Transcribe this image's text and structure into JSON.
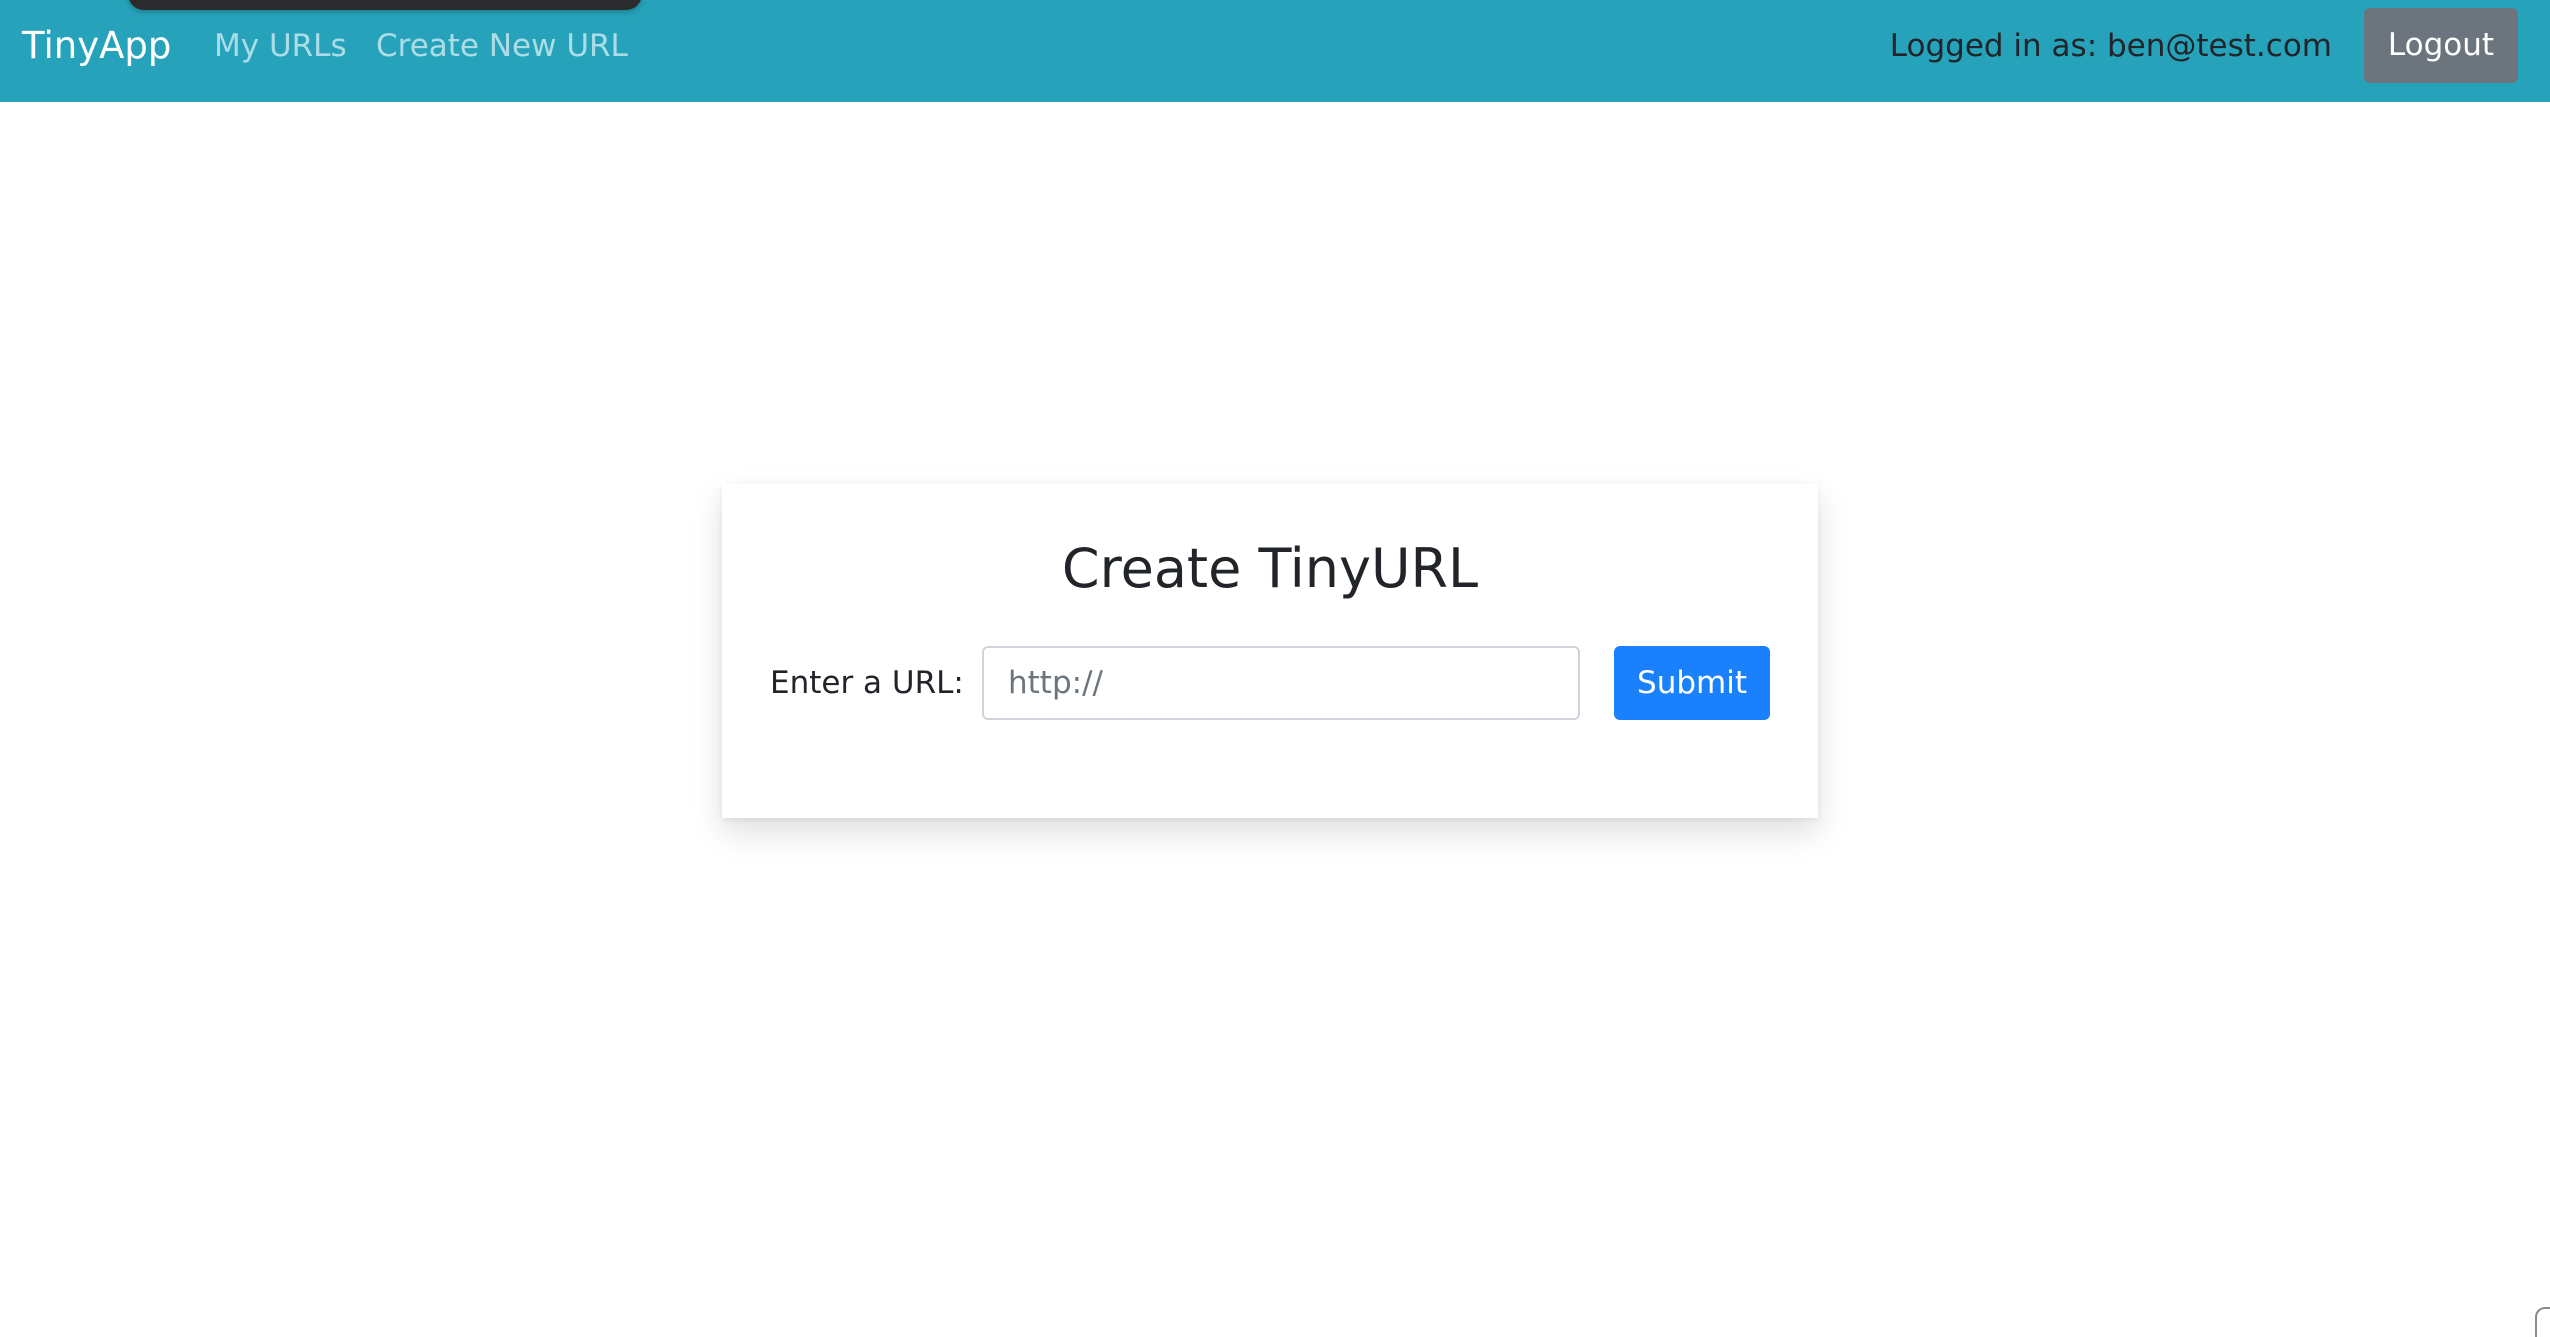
{
  "navbar": {
    "brand": "TinyApp",
    "links": [
      {
        "label": "My URLs"
      },
      {
        "label": "Create New URL"
      }
    ],
    "login_status": "Logged in as: ben@test.com",
    "logout_label": "Logout",
    "background_color": "#26a3bb"
  },
  "main": {
    "card": {
      "title": "Create TinyURL",
      "url_label": "Enter a URL:",
      "url_input": {
        "value": "",
        "placeholder": "http://"
      },
      "submit_label": "Submit"
    }
  },
  "colors": {
    "accent": "#1b80fb",
    "secondary_button": "#6c757d",
    "text": "#212529"
  }
}
